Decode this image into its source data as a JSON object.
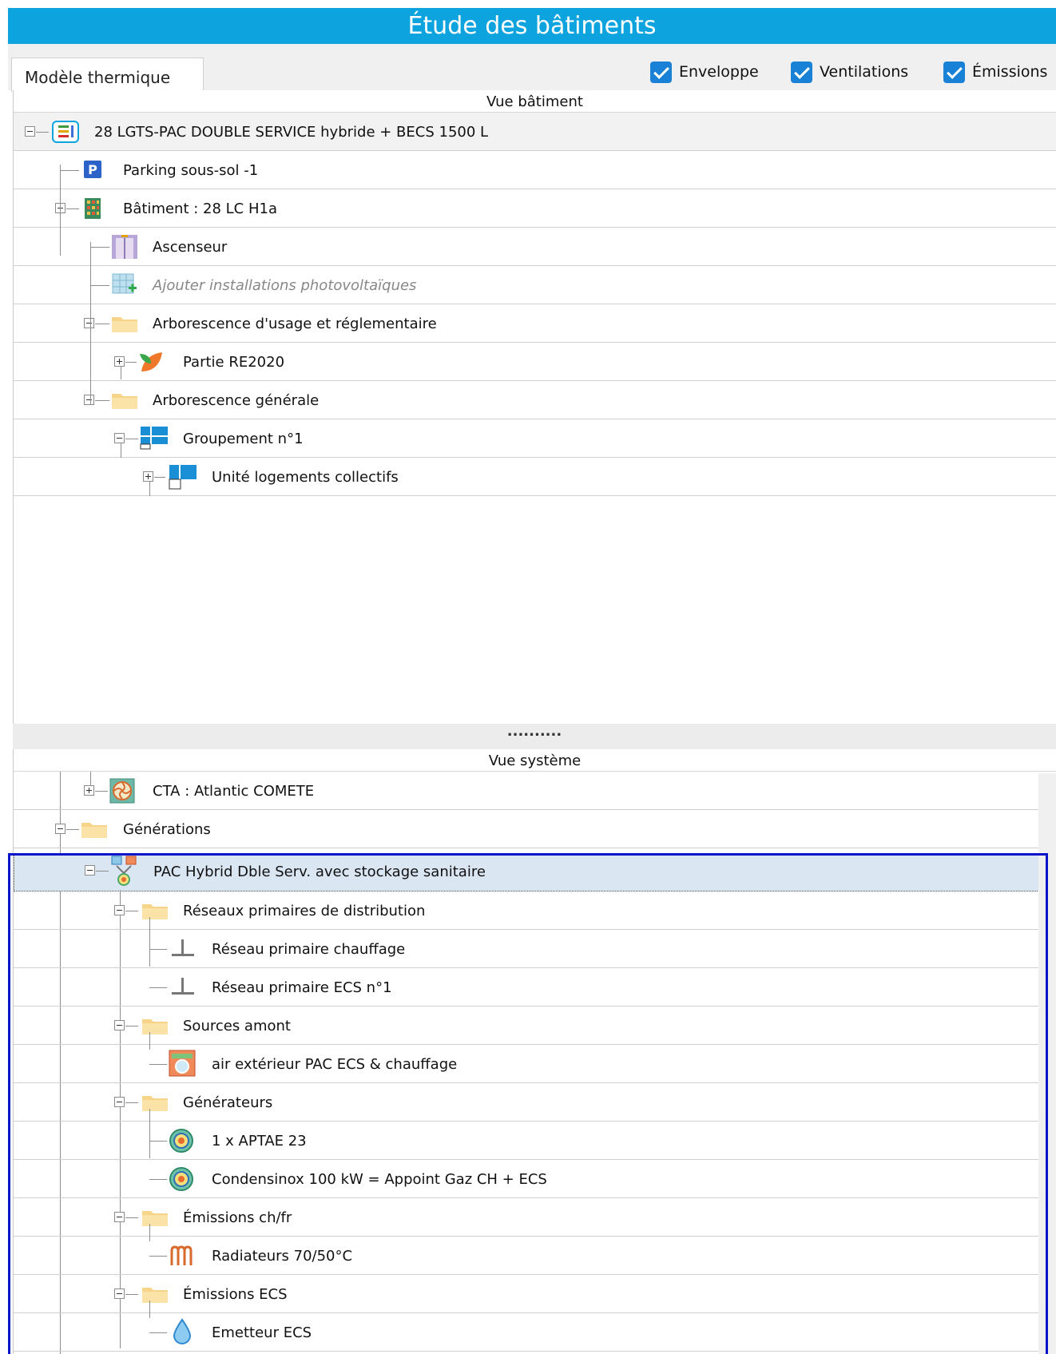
{
  "title": "Étude des bâtiments",
  "tab": "Modèle thermique",
  "filters": [
    {
      "label": "Enveloppe",
      "checked": true
    },
    {
      "label": "Ventilations",
      "checked": true
    },
    {
      "label": "Émissions",
      "checked": true
    }
  ],
  "building_view": {
    "title": "Vue bâtiment",
    "items": [
      "28 LGTS-PAC DOUBLE SERVICE hybride + BECS 1500 L",
      "Parking sous-sol -1",
      "Bâtiment : 28 LC H1a",
      "Ascenseur",
      "Ajouter installations photovoltaïques",
      "Arborescence d'usage et réglementaire",
      "Partie RE2020",
      "Arborescence générale",
      "Groupement n°1",
      "Unité logements collectifs"
    ]
  },
  "splitter": "..........",
  "system_view": {
    "title": "Vue système",
    "items": [
      "CTA : Atlantic COMETE",
      "Générations",
      "PAC Hybrid Dble Serv. avec stockage sanitaire",
      "Réseaux primaires de distribution",
      "Réseau primaire chauffage",
      "Réseau primaire ECS n°1",
      "Sources amont",
      "air extérieur PAC ECS & chauffage",
      "Générateurs",
      "1 x APTAE 23",
      "Condensinox 100 kW = Appoint Gaz CH + ECS",
      "Émissions ch/fr",
      "Radiateurs 70/50°C",
      "Émissions ECS",
      "Emetteur ECS"
    ]
  },
  "colors": {
    "accent": "#0ca3de",
    "selection_frame": "#0a14c8",
    "checkbox": "#1a82d6"
  }
}
